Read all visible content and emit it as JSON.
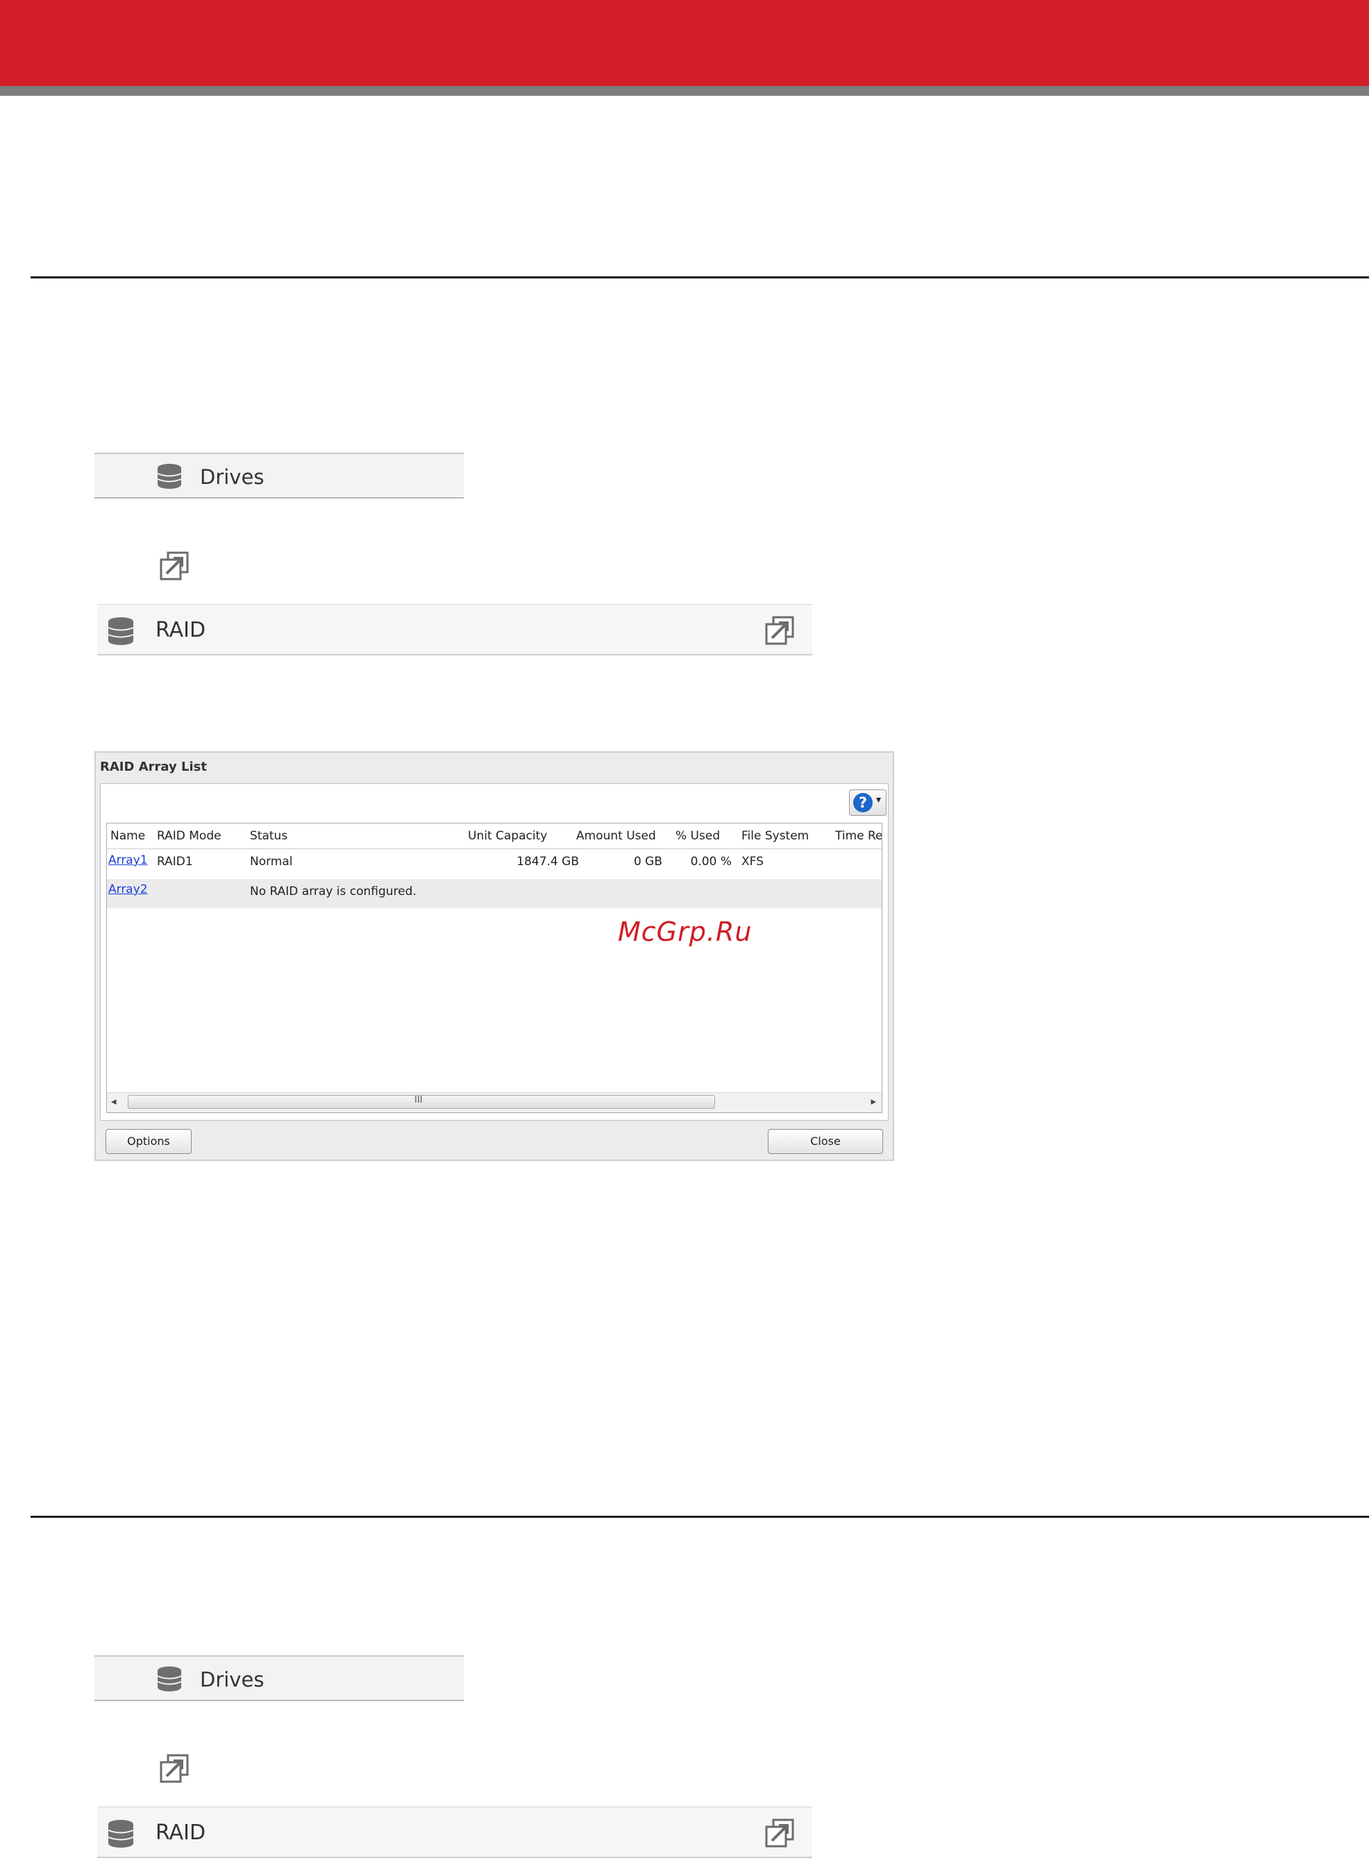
{
  "drives_bar": {
    "label": "Drives"
  },
  "raid_bar": {
    "label": "RAID"
  },
  "dialog": {
    "title": "RAID Array List",
    "columns": [
      "Name",
      "RAID Mode",
      "Status",
      "Unit Capacity",
      "Amount Used",
      "% Used",
      "File System",
      "Time Re"
    ],
    "rows": [
      {
        "name": "Array1",
        "raid_mode": "RAID1",
        "status": "Normal",
        "unit_capacity": "1847.4 GB",
        "amount_used": "0 GB",
        "pct_used": "0.00 %",
        "file_system": "XFS"
      },
      {
        "name": "Array2",
        "status": "No RAID array is configured."
      }
    ],
    "scrollbar_grip": "III",
    "scroll_left": "◂",
    "scroll_right": "▸",
    "help_mark": "?",
    "help_caret": "▾",
    "options_label": "Options",
    "close_label": "Close"
  },
  "watermark": "McGrp.Ru"
}
